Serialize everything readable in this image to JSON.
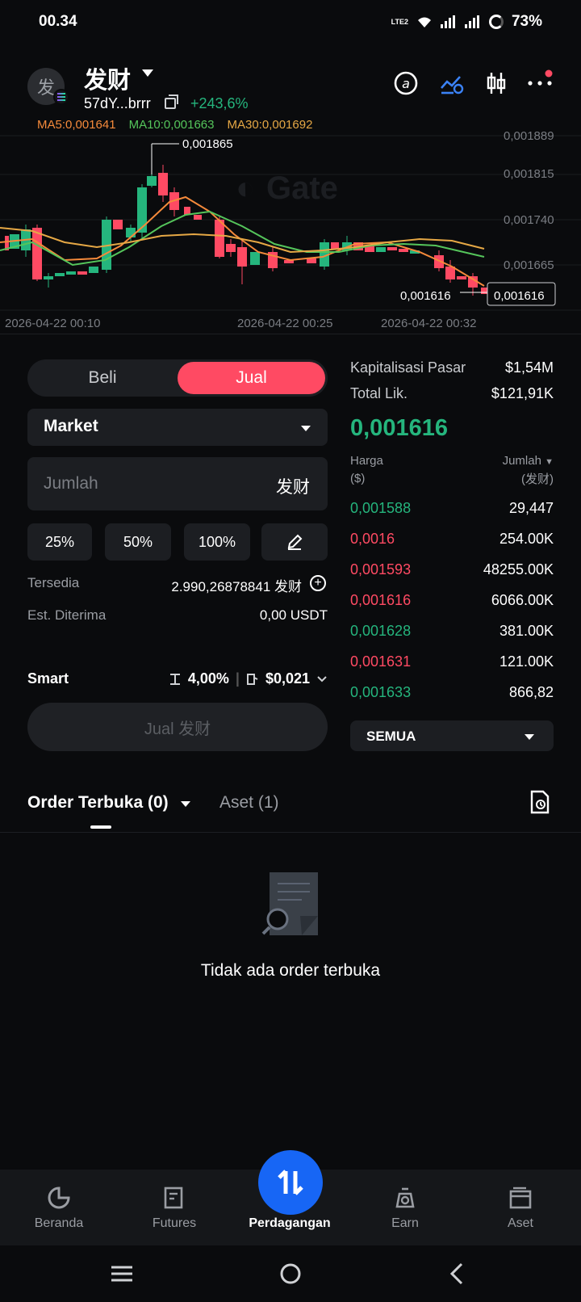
{
  "status_bar": {
    "time": "00.34",
    "battery": "73%",
    "net": "LTE2"
  },
  "header": {
    "token_name": "发财",
    "avatar_char": "发",
    "address": "57dY...brrr",
    "change": "+243,6%"
  },
  "chart": {
    "ma": {
      "ma5": "MA5:0,001641",
      "ma10": "MA10:0,001663",
      "ma30": "MA30:0,001692"
    },
    "y_ticks": [
      "0,001889",
      "0,001815",
      "0,001740",
      "0,001665"
    ],
    "high_label": "0,001865",
    "last_label": "0,001616",
    "last_tag": "0,001616",
    "x_ticks": [
      "2026-04-22 00:10",
      "2026-04-22 00:25",
      "2026-04-22 00:32"
    ],
    "watermark": "Gate"
  },
  "trade": {
    "buy_label": "Beli",
    "sell_label": "Jual",
    "order_type": "Market",
    "amount_placeholder": "Jumlah",
    "amount_unit": "发财",
    "pct": [
      "25%",
      "50%",
      "100%"
    ],
    "available_label": "Tersedia",
    "available_value": "2.990,26878841 发财",
    "receive_label": "Est. Diterima",
    "receive_value": "0,00 USDT",
    "smart_label": "Smart",
    "slippage": "4,00%",
    "fee": "$0,021",
    "submit_label": "Jual 发财"
  },
  "market": {
    "cap_label": "Kapitalisasi Pasar",
    "cap_value": "$1,54M",
    "liq_label": "Total Lik.",
    "liq_value": "$121,91K",
    "last_price": "0,001616",
    "col_price": "Harga",
    "col_price_unit": "($)",
    "col_amount": "Jumlah",
    "col_amount_unit": "(发财)",
    "rows": [
      {
        "price": "0,001588",
        "qty": "29,447",
        "side": "buy"
      },
      {
        "price": "0,0016",
        "qty": "254.00K",
        "side": "sell"
      },
      {
        "price": "0,001593",
        "qty": "48255.00K",
        "side": "sell"
      },
      {
        "price": "0,001616",
        "qty": "6066.00K",
        "side": "sell"
      },
      {
        "price": "0,001628",
        "qty": "381.00K",
        "side": "buy"
      },
      {
        "price": "0,001631",
        "qty": "121.00K",
        "side": "sell"
      },
      {
        "price": "0,001633",
        "qty": "866,82",
        "side": "buy"
      }
    ],
    "filter": "SEMUA"
  },
  "orders": {
    "tab_open": "Order Terbuka (0)",
    "tab_assets": "Aset (1)",
    "empty": "Tidak ada order terbuka"
  },
  "nav": {
    "home": "Beranda",
    "futures": "Futures",
    "trade": "Perdagangan",
    "earn": "Earn",
    "assets": "Aset"
  },
  "colors": {
    "up": "#25b57d",
    "down": "#ff4a63",
    "accent": "#1766f5"
  }
}
